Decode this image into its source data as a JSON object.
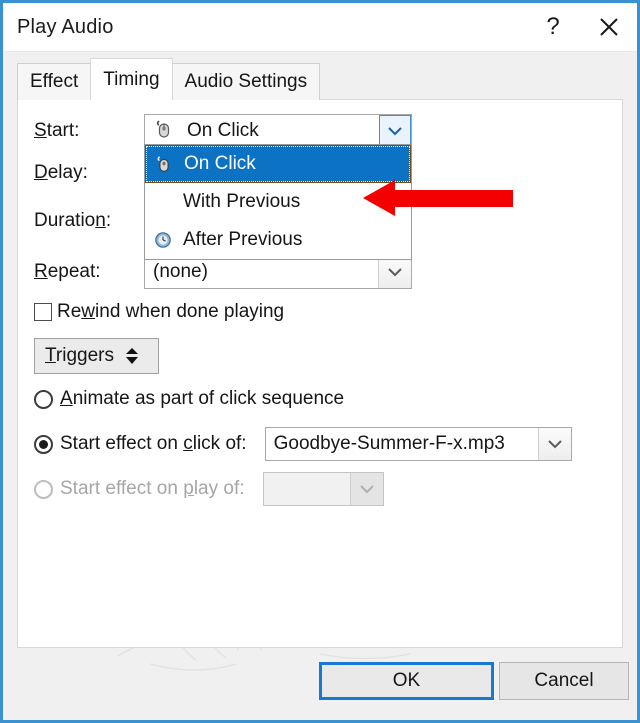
{
  "window": {
    "title": "Play Audio",
    "help_button": "?",
    "close_button": "✕"
  },
  "tabs": [
    {
      "label": "Effect",
      "active": false
    },
    {
      "label": "Timing",
      "active": true
    },
    {
      "label": "Audio Settings",
      "active": false
    }
  ],
  "timing": {
    "start": {
      "label": "Start:",
      "mnemonic": "S",
      "value": "On Click",
      "icon": "mouse-click-icon",
      "expanded": true,
      "options": [
        {
          "label": "On Click",
          "icon": "mouse-click-icon",
          "selected": true
        },
        {
          "label": "With Previous",
          "icon": "none",
          "selected": false
        },
        {
          "label": "After Previous",
          "icon": "clock-icon",
          "selected": false
        }
      ]
    },
    "delay": {
      "label": "Delay:",
      "mnemonic": "D"
    },
    "duration": {
      "label": "Duration:",
      "mnemonic": "n"
    },
    "repeat": {
      "label": "Repeat:",
      "mnemonic": "R",
      "value": "(none)"
    },
    "rewind": {
      "label": "Rewind when done playing",
      "checked": false
    },
    "triggers": {
      "label": "Triggers",
      "expander": "▲▼"
    },
    "animate_click_sequence": {
      "label": "Animate as part of click sequence",
      "selected": false
    },
    "start_effect_on_click": {
      "label": "Start effect on click of:",
      "selected": true,
      "value": "Goodbye-Summer-F-x.mp3"
    },
    "start_effect_on_play": {
      "label": "Start effect on play of:",
      "selected": false,
      "disabled": true,
      "value": ""
    }
  },
  "footer": {
    "ok": "OK",
    "cancel": "Cancel"
  },
  "annotation": {
    "arrow": "red-left-arrow",
    "color": "#f40000"
  },
  "colors": {
    "dialog_border": "#3a92d2",
    "selection": "#0b72c4",
    "default_button_border": "#1879d4"
  }
}
